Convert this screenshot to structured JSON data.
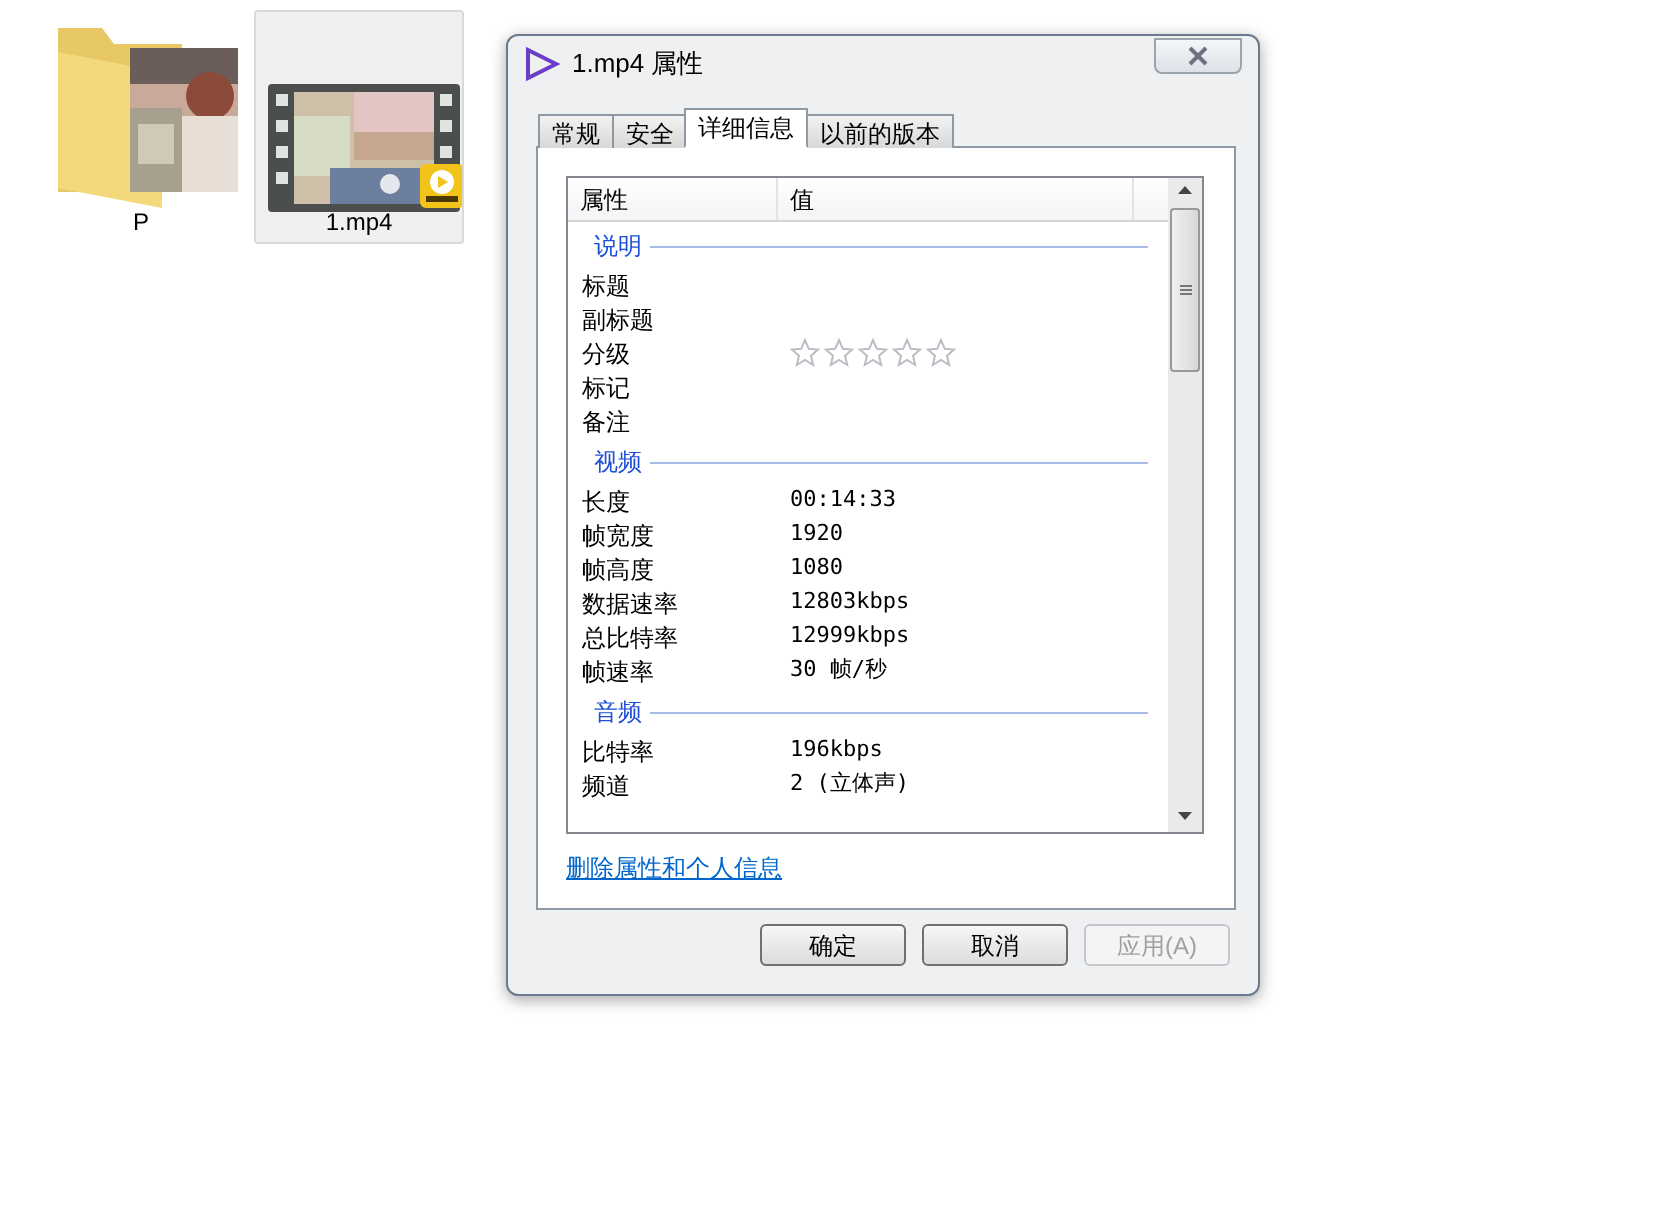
{
  "desktop_icons": [
    {
      "label": "P",
      "kind": "folder",
      "selected": false
    },
    {
      "label": "1.mp4",
      "kind": "video",
      "selected": true
    }
  ],
  "dialog": {
    "title": "1.mp4 属性",
    "tabs": [
      {
        "label": "常规",
        "selected": false
      },
      {
        "label": "安全",
        "selected": false
      },
      {
        "label": "详细信息",
        "selected": true
      },
      {
        "label": "以前的版本",
        "selected": false
      }
    ],
    "columns": [
      "属性",
      "值"
    ],
    "sections": [
      {
        "title": "说明",
        "rows": [
          {
            "kind": "text",
            "name": "标题"
          },
          {
            "kind": "text",
            "name": "副标题"
          },
          {
            "kind": "rating",
            "name": "分级",
            "stars": 0
          },
          {
            "kind": "text",
            "name": "标记"
          },
          {
            "kind": "text",
            "name": "备注"
          }
        ]
      },
      {
        "title": "视频",
        "rows": [
          {
            "kind": "text",
            "name": "长度",
            "value": "00:14:33"
          },
          {
            "kind": "text",
            "name": "帧宽度",
            "value": "1920"
          },
          {
            "kind": "text",
            "name": "帧高度",
            "value": "1080"
          },
          {
            "kind": "text",
            "name": "数据速率",
            "value": "12803kbps"
          },
          {
            "kind": "text",
            "name": "总比特率",
            "value": "12999kbps"
          },
          {
            "kind": "text",
            "name": "帧速率",
            "value": "30 帧/秒"
          }
        ]
      },
      {
        "title": "音频",
        "rows": [
          {
            "kind": "text",
            "name": "比特率",
            "value": "196kbps"
          },
          {
            "kind": "text",
            "name": "频道",
            "value": "2 (立体声)"
          }
        ]
      }
    ],
    "link": "删除属性和个人信息",
    "buttons": [
      {
        "label": "确定",
        "disabled": false
      },
      {
        "label": "取消",
        "disabled": false
      },
      {
        "label": "应用(A)",
        "disabled": true
      }
    ]
  }
}
